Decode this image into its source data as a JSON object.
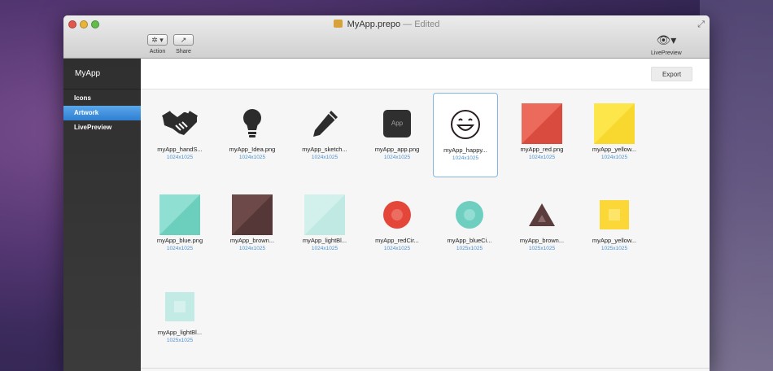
{
  "window": {
    "title": "MyApp.prepo",
    "status": "— Edited"
  },
  "toolbar": {
    "action_label": "Action",
    "action_glyph": "✲ ▾",
    "share_label": "Share",
    "share_glyph": "↗",
    "livepreview_label": "LivePreview",
    "livepreview_glyph": "👁▾"
  },
  "sidebar": {
    "app_name": "MyApp",
    "items": [
      {
        "label": "Icons",
        "active": false
      },
      {
        "label": "Artwork",
        "active": true
      },
      {
        "label": "LivePreview",
        "active": false
      }
    ]
  },
  "main": {
    "export_label": "Export",
    "app_tile_text": "App"
  },
  "assets": [
    {
      "name": "myApp_handS...",
      "dims": "1024x1025",
      "icon": "handshake-icon"
    },
    {
      "name": "myApp_Idea.png",
      "dims": "1024x1025",
      "icon": "lightbulb-icon"
    },
    {
      "name": "myApp_sketch...",
      "dims": "1024x1025",
      "icon": "pencil-icon"
    },
    {
      "name": "myApp_app.png",
      "dims": "1024x1025",
      "icon": "app-icon"
    },
    {
      "name": "myApp_happy...",
      "dims": "1024x1025",
      "icon": "smiley-icon"
    },
    {
      "name": "myApp_red.png",
      "dims": "1024x1025",
      "icon": "red-square-icon",
      "color": "#e8574a"
    },
    {
      "name": "myApp_yellow...",
      "dims": "1024x1025",
      "icon": "yellow-square-icon",
      "color": "#fbd838"
    },
    {
      "name": "myApp_blue.png",
      "dims": "1024x1025",
      "icon": "blue-square-icon",
      "color": "#7ed6c8"
    },
    {
      "name": "myApp_brown...",
      "dims": "1024x1025",
      "icon": "brown-square-icon",
      "color": "#634141"
    },
    {
      "name": "myApp_lightBl...",
      "dims": "1024x1025",
      "icon": "lightblue-square-icon",
      "color": "#c3ebe5"
    },
    {
      "name": "myApp_redCir...",
      "dims": "1024x1025",
      "icon": "red-circle-icon",
      "color": "#e4473a"
    },
    {
      "name": "myApp_blueCi...",
      "dims": "1025x1025",
      "icon": "blue-circle-icon",
      "color": "#6ecfc1"
    },
    {
      "name": "myApp_brown...",
      "dims": "1025x1025",
      "icon": "brown-triangle-icon",
      "color": "#5c3d3d"
    },
    {
      "name": "myApp_yellow...",
      "dims": "1025x1025",
      "icon": "yellow-small-square-icon",
      "color": "#fbd838"
    },
    {
      "name": "myApp_lightBl...",
      "dims": "1025x1025",
      "icon": "lightblue-small-square-icon",
      "color": "#c3ebe5"
    }
  ]
}
